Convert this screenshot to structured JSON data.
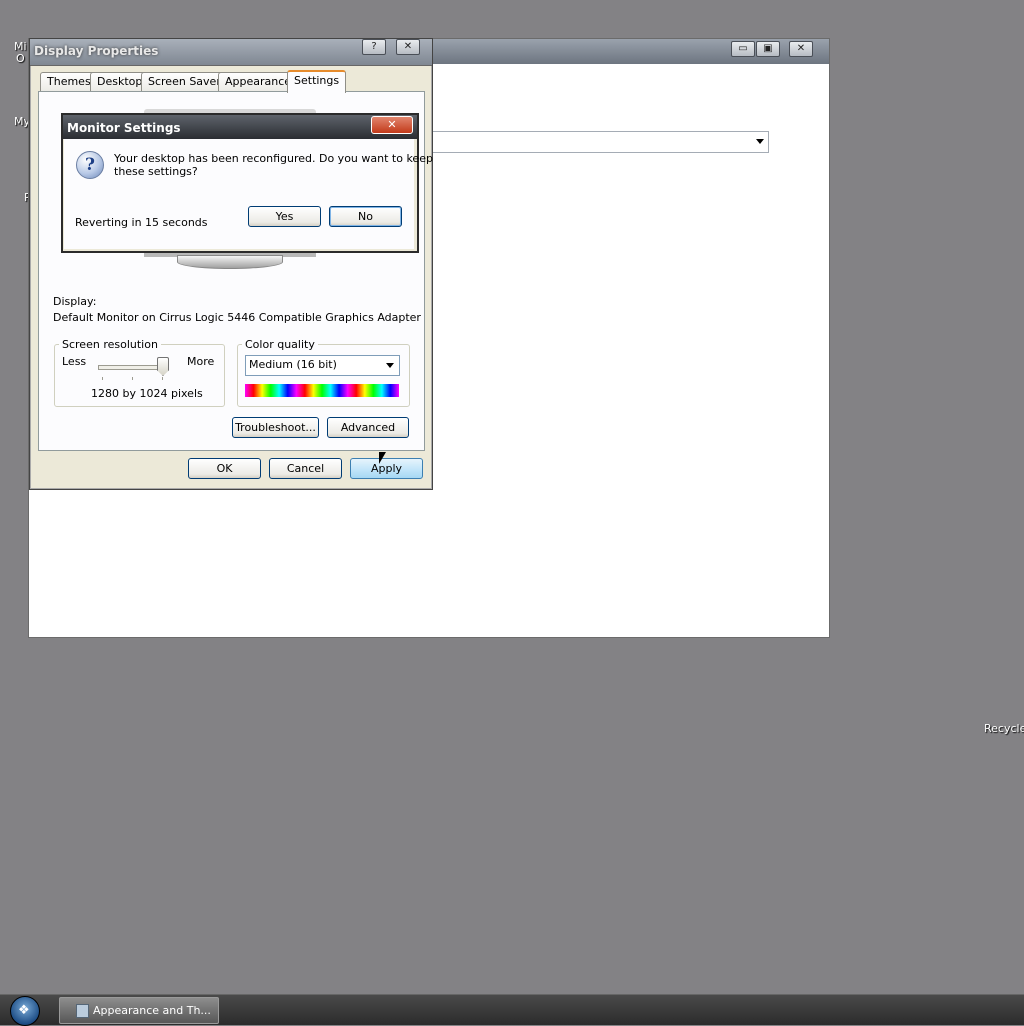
{
  "desktop": {
    "icon_labels": [
      "Mi",
      "O",
      "My",
      "R"
    ],
    "recycle_label": "Recycle"
  },
  "display_properties": {
    "title": "Display Properties",
    "help_glyph": "?",
    "close_glyph": "✕",
    "tabs": [
      "Themes",
      "Desktop",
      "Screen Saver",
      "Appearance",
      "Settings"
    ],
    "active_tab": "Settings",
    "display_label": "Display:",
    "display_value": "Default Monitor on Cirrus Logic 5446 Compatible Graphics Adapter",
    "resolution": {
      "legend": "Screen resolution",
      "less": "Less",
      "more": "More",
      "value_text": "1280 by 1024 pixels",
      "slider_fraction": 1.0
    },
    "color_quality": {
      "legend": "Color quality",
      "selected": "Medium (16 bit)"
    },
    "buttons": {
      "troubleshoot": "Troubleshoot...",
      "advanced": "Advanced",
      "ok": "OK",
      "cancel": "Cancel",
      "apply": "Apply"
    }
  },
  "monitor_settings": {
    "title": "Monitor Settings",
    "close_glyph": "✕",
    "icon_glyph": "?",
    "message_line1": "Your desktop has been reconfigured.  Do you want to keep",
    "message_line2": "these settings?",
    "countdown": "Reverting in 15 seconds",
    "yes": "Yes",
    "no": "No"
  },
  "background_window": {
    "min_glyph": "▭",
    "max_glyph": "▣",
    "close_glyph": "✕"
  },
  "taskbar": {
    "start_glyph": "❖",
    "task_button": "Appearance and Th..."
  }
}
